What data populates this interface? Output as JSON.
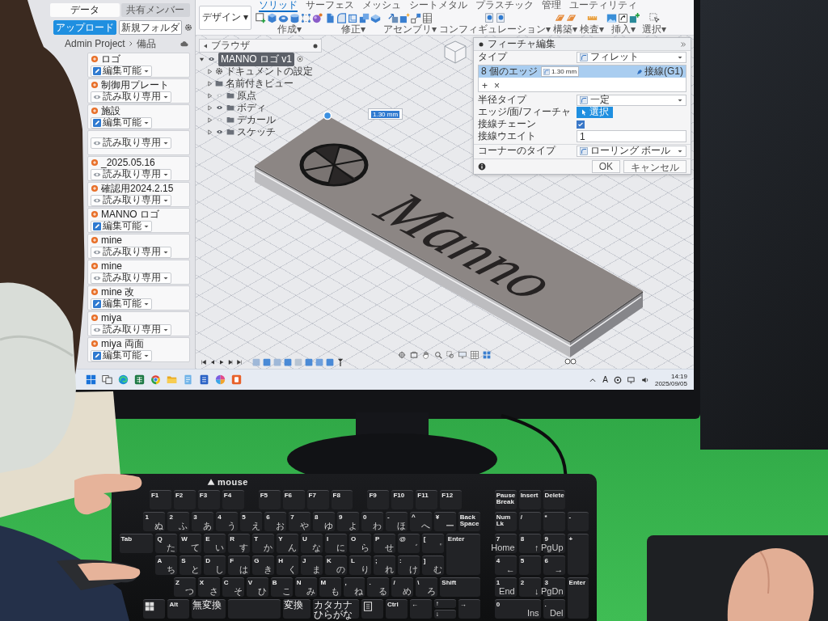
{
  "data_panel": {
    "tabs": [
      {
        "label": "データ",
        "selected": true
      },
      {
        "label": "共有メンバー",
        "selected": false
      }
    ],
    "buttons": [
      {
        "label": "アップロード",
        "kind": "primary"
      },
      {
        "label": "新規フォルダ",
        "kind": "secondary"
      }
    ],
    "breadcrumb": [
      "Admin Project",
      "備品"
    ],
    "files": [
      {
        "name": "ロゴ",
        "access": "編集可能",
        "editable": true
      },
      {
        "name": "制御用プレート",
        "access": "読み取り専用",
        "editable": false
      },
      {
        "name": "施設",
        "access": "編集可能",
        "editable": true
      },
      {
        "access": "読み取り専用",
        "editable": false
      },
      {
        "name": "_2025.05.16",
        "access": "読み取り専用",
        "editable": false
      },
      {
        "name": "確認用2024.2.15",
        "access": "読み取り専用",
        "editable": false
      },
      {
        "name": "MANNO ロゴ",
        "access": "編集可能",
        "editable": true
      },
      {
        "name": "mine",
        "access": "読み取り専用",
        "editable": false
      },
      {
        "name": "mine",
        "access": "読み取り専用",
        "editable": false
      },
      {
        "name": "mine 改",
        "access": "編集可能",
        "editable": true
      },
      {
        "name": "miya",
        "access": "読み取り専用",
        "editable": false
      },
      {
        "name": "miya 両面",
        "access": "編集可能",
        "editable": true
      }
    ]
  },
  "toolbar": {
    "workspace": "デザイン ▾",
    "tabs": [
      {
        "label": "ソリッド",
        "selected": true
      },
      {
        "label": "サーフェス",
        "selected": false
      },
      {
        "label": "メッシュ",
        "selected": false
      },
      {
        "label": "シートメタル",
        "selected": false
      },
      {
        "label": "プラスチック",
        "selected": false
      },
      {
        "label": "管理",
        "selected": false
      },
      {
        "label": "ユーティリティ",
        "selected": false
      }
    ],
    "groups": [
      "作成▾",
      "修正▾",
      "アセンブリ▾",
      "コンフィギュレーション▾",
      "構築▾",
      "検査▾",
      "挿入▾",
      "選択▾"
    ]
  },
  "browser": {
    "title": "ブラウザ",
    "root": {
      "label": "MANNO ロゴ v1",
      "active": true,
      "expanded": true,
      "visible": true
    },
    "settings": [
      {
        "label": "ドキュメントの設定",
        "expanded": false
      },
      {
        "label": "名前付きビュー",
        "expanded": false
      }
    ],
    "folders": [
      {
        "label": "原点",
        "expanded": false,
        "visible": false
      },
      {
        "label": "ボディ",
        "expanded": false,
        "visible": true
      },
      {
        "label": "デカール",
        "expanded": false,
        "visible": false
      },
      {
        "label": "スケッチ",
        "expanded": false,
        "visible": true
      }
    ]
  },
  "model": {
    "engraving": "Manno",
    "radius_tag": "1.30 mm"
  },
  "dialog": {
    "title": "フィーチャ編集",
    "type": {
      "label": "タイプ",
      "value": "フィレット"
    },
    "selection": {
      "count": "8 個のエッジ",
      "radius": "1.30 mm",
      "continuity": "接線(G1)",
      "selected": true
    },
    "actions": [
      "+",
      "×"
    ],
    "rows": [
      {
        "kind": "dropdown",
        "label": "半径タイプ",
        "value": "一定"
      },
      {
        "kind": "select-button",
        "label": "エッジ/面/フィーチャ",
        "value": "選択"
      },
      {
        "kind": "checkbox",
        "label": "接線チェーン",
        "checked": true
      },
      {
        "kind": "input",
        "label": "接線ウエイト",
        "value": "1"
      },
      {
        "kind": "dropdown",
        "label": "コーナーのタイプ",
        "value": "ローリング ボール"
      }
    ],
    "buttons": [
      "OK",
      "キャンセル"
    ]
  },
  "taskbar": {
    "ime": "A",
    "time": "14:19",
    "date": "2025/09/05"
  },
  "keyboard": {
    "brand": "mouse",
    "keys": [
      {
        "kind": "key",
        "label": "F1"
      },
      {
        "kind": "key",
        "label": "F2"
      },
      {
        "kind": "key",
        "label": "F3"
      },
      {
        "kind": "key",
        "label": "F4"
      },
      {
        "kind": "key",
        "label": "F5"
      },
      {
        "kind": "key",
        "label": "F6"
      },
      {
        "kind": "key",
        "label": "F7"
      },
      {
        "kind": "key",
        "label": "F8"
      },
      {
        "kind": "key",
        "label": "F9"
      },
      {
        "kind": "key",
        "label": "F10"
      },
      {
        "kind": "key",
        "label": "F11"
      },
      {
        "kind": "key",
        "label": "F12"
      },
      {
        "kind": "key",
        "label": "Pause Break"
      },
      {
        "kind": "key",
        "label": "Insert"
      },
      {
        "kind": "key",
        "label": "Delete"
      },
      {
        "kind": "key",
        "label": "1",
        "sub": "ぬ"
      },
      {
        "kind": "key",
        "label": "2",
        "sub": "ふ"
      },
      {
        "kind": "key",
        "label": "3",
        "sub": "あ"
      },
      {
        "kind": "key",
        "label": "4",
        "sub": "う"
      },
      {
        "kind": "key",
        "label": "5",
        "sub": "え"
      },
      {
        "kind": "key",
        "label": "6",
        "sub": "お"
      },
      {
        "kind": "key",
        "label": "7",
        "sub": "や"
      },
      {
        "kind": "key",
        "label": "8",
        "sub": "ゆ"
      },
      {
        "kind": "key",
        "label": "9",
        "sub": "よ"
      },
      {
        "kind": "key",
        "label": "0",
        "sub": "わ"
      },
      {
        "kind": "key",
        "label": "-",
        "sub": "ほ"
      },
      {
        "kind": "key",
        "label": "^",
        "sub": "へ"
      },
      {
        "kind": "key",
        "label": "¥",
        "sub": "ー"
      },
      {
        "kind": "key",
        "label": "Back Space"
      },
      {
        "kind": "key",
        "label": "Num Lk"
      },
      {
        "kind": "key",
        "label": "/"
      },
      {
        "kind": "key",
        "label": "*"
      },
      {
        "kind": "key",
        "label": "-"
      },
      {
        "kind": "key",
        "label": "Tab"
      },
      {
        "kind": "key",
        "label": "Q",
        "sub": "た"
      },
      {
        "kind": "key",
        "label": "W",
        "sub": "て"
      },
      {
        "kind": "key",
        "label": "E",
        "sub": "い"
      },
      {
        "kind": "key",
        "label": "R",
        "sub": "す"
      },
      {
        "kind": "key",
        "label": "T",
        "sub": "か"
      },
      {
        "kind": "key",
        "label": "Y",
        "sub": "ん"
      },
      {
        "kind": "key",
        "label": "U",
        "sub": "な"
      },
      {
        "kind": "key",
        "label": "I",
        "sub": "に"
      },
      {
        "kind": "key",
        "label": "O",
        "sub": "ら"
      },
      {
        "kind": "key",
        "label": "P",
        "sub": "せ"
      },
      {
        "kind": "key",
        "label": "@",
        "sub": "゛"
      },
      {
        "kind": "key",
        "label": "[",
        "sub": "゜"
      },
      {
        "kind": "key",
        "label": "Enter"
      },
      {
        "kind": "key",
        "label": "7",
        "sub": "Home"
      },
      {
        "kind": "key",
        "label": "8",
        "sub": "↑"
      },
      {
        "kind": "key",
        "label": "9",
        "sub": "PgUp"
      },
      {
        "kind": "key",
        "label": "+"
      },
      {
        "kind": "key",
        "label": "A",
        "sub": "ち"
      },
      {
        "kind": "key",
        "label": "S",
        "sub": "と"
      },
      {
        "kind": "key",
        "label": "D",
        "sub": "し"
      },
      {
        "kind": "key",
        "label": "F",
        "sub": "は"
      },
      {
        "kind": "key",
        "label": "G",
        "sub": "き"
      },
      {
        "kind": "key",
        "label": "H",
        "sub": "く"
      },
      {
        "kind": "key",
        "label": "J",
        "sub": "ま"
      },
      {
        "kind": "key",
        "label": "K",
        "sub": "の"
      },
      {
        "kind": "key",
        "label": "L",
        "sub": "り"
      },
      {
        "kind": "key",
        "label": ";",
        "sub": "れ"
      },
      {
        "kind": "key",
        "label": ":",
        "sub": "け"
      },
      {
        "kind": "key",
        "label": "]",
        "sub": "む"
      },
      {
        "kind": "key",
        "label": "4",
        "sub": "←"
      },
      {
        "kind": "key",
        "label": "5"
      },
      {
        "kind": "key",
        "label": "6",
        "sub": "→"
      },
      {
        "kind": "key",
        "label": "Z",
        "sub": "つ"
      },
      {
        "kind": "key",
        "label": "X",
        "sub": "さ"
      },
      {
        "kind": "key",
        "label": "C",
        "sub": "そ"
      },
      {
        "kind": "key",
        "label": "V",
        "sub": "ひ"
      },
      {
        "kind": "key",
        "label": "B",
        "sub": "こ"
      },
      {
        "kind": "key",
        "label": "N",
        "sub": "み"
      },
      {
        "kind": "key",
        "label": "M",
        "sub": "も"
      },
      {
        "kind": "key",
        "label": ",",
        "sub": "ね"
      },
      {
        "kind": "key",
        "label": ".",
        "sub": "る"
      },
      {
        "kind": "key",
        "label": "/",
        "sub": "め"
      },
      {
        "kind": "key",
        "label": "\\",
        "sub": "ろ"
      },
      {
        "kind": "key",
        "label": "Shift"
      },
      {
        "kind": "key",
        "label": "1",
        "sub": "End"
      },
      {
        "kind": "key",
        "label": "2",
        "sub": "↓"
      },
      {
        "kind": "key",
        "label": "3",
        "sub": "PgDn"
      },
      {
        "kind": "key",
        "label": "Enter"
      },
      {
        "kind": "win"
      },
      {
        "kind": "key",
        "label": "Alt"
      },
      {
        "kind": "jp",
        "label": "無変換"
      },
      {
        "kind": "space"
      },
      {
        "kind": "jp",
        "label": "変換"
      },
      {
        "kind": "jp",
        "label": "カタカナひらがな"
      },
      {
        "kind": "menu"
      },
      {
        "kind": "key",
        "label": "Ctrl"
      },
      {
        "kind": "key",
        "label": "←"
      },
      {
        "kind": "key",
        "label": "↑"
      },
      {
        "kind": "key",
        "label": "↓"
      },
      {
        "kind": "key",
        "label": "→"
      },
      {
        "kind": "key",
        "label": "0",
        "sub": "Ins"
      },
      {
        "kind": "key",
        "label": ".",
        "sub": "Del"
      }
    ]
  }
}
